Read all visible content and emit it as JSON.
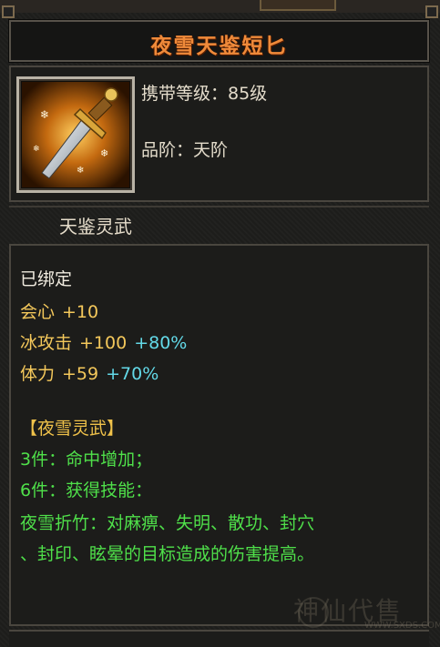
{
  "item": {
    "title": "夜雪天鉴短匕",
    "level_line": "携带等级：85级",
    "grade_line": "品阶：天阶",
    "subtitle": "天鉴灵武",
    "bound": "已绑定"
  },
  "stats": [
    {
      "name": "会心",
      "base": "+10",
      "pct": ""
    },
    {
      "name": "冰攻击",
      "base": "+100",
      "pct": "+80%"
    },
    {
      "name": "体力",
      "base": "+59",
      "pct": "+70%"
    }
  ],
  "set": {
    "title": "【夜雪灵武】",
    "lines": [
      "3件：命中增加；",
      "6件：获得技能：",
      "夜雪折竹：对麻痹、失明、散功、封穴",
      "、封印、眩晕的目标造成的伤害提高。"
    ]
  },
  "watermark": {
    "text": "神仙代售",
    "url": "WWW.SXDS.COM"
  },
  "colors": {
    "title": "#ef8a3a",
    "stat_gold": "#f4c85b",
    "stat_cyan": "#63d9e8",
    "set_green": "#4fe04a"
  }
}
